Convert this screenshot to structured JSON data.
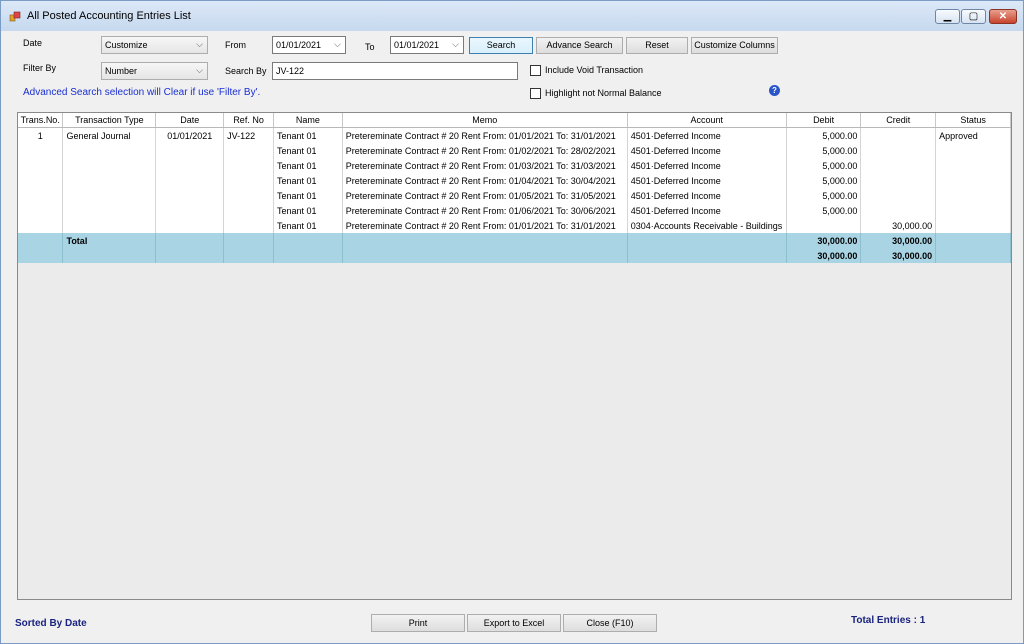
{
  "window": {
    "title": "All Posted Accounting Entries List"
  },
  "filters": {
    "date_label": "Date",
    "date_mode": "Customize",
    "from_label": "From",
    "from_value": "01/01/2021",
    "to_label": "To",
    "to_value": "01/01/2021",
    "filter_by_label": "Filter By",
    "filter_by_value": "Number",
    "search_by_label": "Search By",
    "search_by_value": "JV-122",
    "include_void_label": "Include Void Transaction",
    "highlight_label": "Highlight not Normal Balance",
    "info_text": "Advanced Search selection will Clear if use 'Filter By'."
  },
  "buttons": {
    "search": "Search",
    "advance_search": "Advance Search",
    "reset": "Reset",
    "customize_columns": "Customize Columns",
    "print": "Print",
    "export_excel": "Export to Excel",
    "close": "Close (F10)"
  },
  "table": {
    "columns": [
      "Trans.No.",
      "Transaction Type",
      "Date",
      "Ref. No",
      "Name",
      "Memo",
      "Account",
      "Debit",
      "Credit",
      "Status"
    ],
    "header": {
      "trans_no": "1",
      "type": "General Journal",
      "date": "01/01/2021",
      "ref": "JV-122",
      "status": "Approved"
    },
    "rows": [
      {
        "name": "Tenant 01",
        "memo": "Pretereminate Contract # 20 Rent From: 01/01/2021 To: 31/01/2021",
        "account": "4501·Deferred Income",
        "debit": "5,000.00",
        "credit": ""
      },
      {
        "name": "Tenant 01",
        "memo": "Pretereminate Contract # 20 Rent From: 01/02/2021 To: 28/02/2021",
        "account": "4501·Deferred Income",
        "debit": "5,000.00",
        "credit": ""
      },
      {
        "name": "Tenant 01",
        "memo": "Pretereminate Contract # 20 Rent From: 01/03/2021 To: 31/03/2021",
        "account": "4501·Deferred Income",
        "debit": "5,000.00",
        "credit": ""
      },
      {
        "name": "Tenant 01",
        "memo": "Pretereminate Contract # 20 Rent From: 01/04/2021 To: 30/04/2021",
        "account": "4501·Deferred Income",
        "debit": "5,000.00",
        "credit": ""
      },
      {
        "name": "Tenant 01",
        "memo": "Pretereminate Contract # 20 Rent From: 01/05/2021 To: 31/05/2021",
        "account": "4501·Deferred Income",
        "debit": "5,000.00",
        "credit": ""
      },
      {
        "name": "Tenant 01",
        "memo": "Pretereminate Contract # 20 Rent From: 01/06/2021 To: 30/06/2021",
        "account": "4501·Deferred Income",
        "debit": "5,000.00",
        "credit": ""
      },
      {
        "name": "Tenant 01",
        "memo": "Pretereminate Contract # 20 Rent From: 01/01/2021 To: 31/01/2021",
        "account": "0304·Accounts Receivable - Buildings",
        "debit": "",
        "credit": "30,000.00"
      }
    ],
    "total_label": "Total",
    "total_debit": "30,000.00",
    "total_credit": "30,000.00",
    "grand_debit": "30,000.00",
    "grand_credit": "30,000.00"
  },
  "footer": {
    "sorted_by": "Sorted By Date",
    "total_entries": "Total Entries : 1"
  }
}
